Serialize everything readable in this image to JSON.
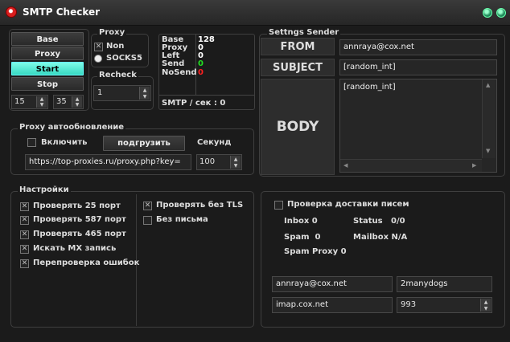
{
  "window": {
    "title": "SMTP Checker"
  },
  "left_buttons": {
    "base": "Base",
    "proxy": "Proxy",
    "start": "Start",
    "stop": "Stop"
  },
  "threads": {
    "value1": "15",
    "value2": "35"
  },
  "proxy_group": {
    "label": "Proxy",
    "option_non": "Non",
    "option_socks5": "SOCKS5"
  },
  "recheck": {
    "label": "Recheck",
    "value": "1"
  },
  "stats": {
    "labels": [
      "Base",
      "Proxy",
      "Left",
      "Send",
      "NoSend"
    ],
    "values": [
      "128",
      "0",
      "0",
      "0",
      "0"
    ],
    "value_colors": [
      "#ffffff",
      "#ffffff",
      "#ffffff",
      "#22dd22",
      "#ff2020"
    ],
    "speed": "SMTP / сек : 0"
  },
  "sender": {
    "group_label": "Settngs Sender",
    "from_label": "FROM",
    "from_value": "annraya@cox.net",
    "subject_label": "SUBJECT",
    "subject_value": "[random_int]",
    "body_label": "BODY",
    "body_value": "[random_int]"
  },
  "proxy_update": {
    "group_label": "Proxy автообновление",
    "enable_label": "Включить",
    "load_button": "подгрузить",
    "seconds_label": "Секунд",
    "url": "https://top-proxies.ru/proxy.php?key=",
    "seconds_value": "100"
  },
  "settings": {
    "group_label": "Настройки",
    "options": [
      {
        "label": "Проверять 25 порт",
        "checked": true
      },
      {
        "label": "Проверять 587 порт",
        "checked": true
      },
      {
        "label": "Проверять 465 порт",
        "checked": true
      },
      {
        "label": "Искать MX запись",
        "checked": true
      },
      {
        "label": "Перепроверка ошибок",
        "checked": true
      }
    ],
    "options_right": [
      {
        "label": "Проверять без TLS",
        "checked": true
      },
      {
        "label": "Без письма",
        "checked": false
      }
    ]
  },
  "delivery": {
    "check_label": "Проверка доставки писем",
    "inbox": "Inbox 0",
    "status": "Status   0/0",
    "spam": "Spam  0",
    "mailbox": "Mailbox N/A",
    "spam_proxy": "Spam Proxy 0",
    "email": "annraya@cox.net",
    "password": "2manydogs",
    "imap": "imap.cox.net",
    "port": "993"
  }
}
